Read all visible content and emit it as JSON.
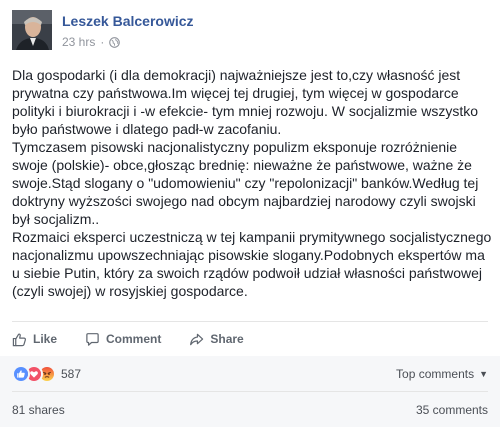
{
  "post": {
    "author": "Leszek Balcerowicz",
    "time": "23 hrs",
    "separator": "·",
    "paragraphs": [
      "Dla gospodarki (i dla demokracji) najważniejsze jest to,czy własność jest prywatna czy państwowa.Im więcej tej drugiej, tym więcej w gospodarce polityki i biurokracji i -w efekcie- tym mniej rozwoju. W socjalizmie wszystko było państwowe i dlatego padł-w zacofaniu.",
      "Tymczasem pisowski nacjonalistyczny populizm eksponuje rozróżnienie swoje (polskie)- obce,głosząc brednię: nieważne że państwowe, ważne że swoje.Stąd slogany o \"udomowieniu\" czy \"repolonizacji\" banków.Według tej doktryny wyższości swojego nad obcym najbardziej narodowy czyli swojski był socjalizm..",
      "Rozmaici eksperci uczestniczą w tej kampanii prymitywnego socjalistycznego nacjonalizmu upowszechniając pisowskie slogany.Podobnych ekspertów ma u siebie Putin, który za swoich rządów podwoił udział własności państwowej (czyli swojej) w rosyjskiej gospodarce."
    ]
  },
  "actions": {
    "like": "Like",
    "comment": "Comment",
    "share": "Share"
  },
  "feedback": {
    "reaction_count": "587",
    "reactions": [
      "like",
      "love",
      "angry"
    ],
    "sort_label": "Top comments",
    "shares": "81 shares",
    "comments": "35 comments"
  },
  "colors": {
    "author": "#365899",
    "meta": "#90949c",
    "like": "#5890ff",
    "love": "#f25268",
    "angry": "#f7714e"
  }
}
